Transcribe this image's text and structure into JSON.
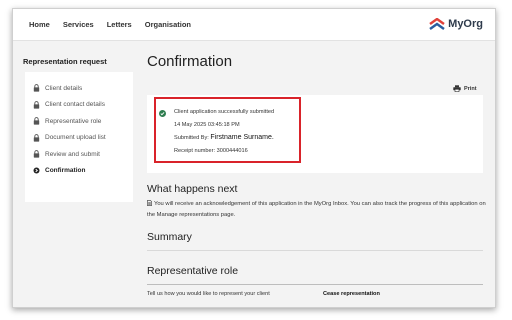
{
  "nav": {
    "links": [
      "Home",
      "Services",
      "Letters",
      "Organisation"
    ],
    "brand": "MyOrg"
  },
  "sidebar": {
    "title": "Representation request",
    "items": [
      {
        "label": "Client details",
        "icon": "lock-icon"
      },
      {
        "label": "Client contact details",
        "icon": "lock-icon"
      },
      {
        "label": "Representative role",
        "icon": "lock-icon"
      },
      {
        "label": "Document upload list",
        "icon": "lock-icon"
      },
      {
        "label": "Review and submit",
        "icon": "lock-icon"
      },
      {
        "label": "Confirmation",
        "icon": "current-step-icon",
        "active": true
      }
    ]
  },
  "main": {
    "title": "Confirmation",
    "print_label": "Print",
    "receipt": {
      "status": "Client application successfully submitted",
      "timestamp": "14 May 2025 03:45:18 PM",
      "submitted_by_label": "Submitted By:",
      "submitted_by_name": "Firstname Surname.",
      "receipt_label": "Receipt number:",
      "receipt_number": "3000444016"
    },
    "what_happens_next": {
      "heading": "What happens next",
      "text": "You will receive an acknowledgement of this application in the MyOrg Inbox. You can also track the progress of this application on the Manage representations page."
    },
    "summary_heading": "Summary",
    "representative_role": {
      "heading": "Representative role",
      "question": "Tell us how you would like to represent your client",
      "answer": "Cease representation"
    }
  },
  "colors": {
    "highlight_border": "#d9232a",
    "success": "#2e7d4f",
    "brand_red": "#e0413a",
    "brand_blue": "#2a5d9f"
  }
}
